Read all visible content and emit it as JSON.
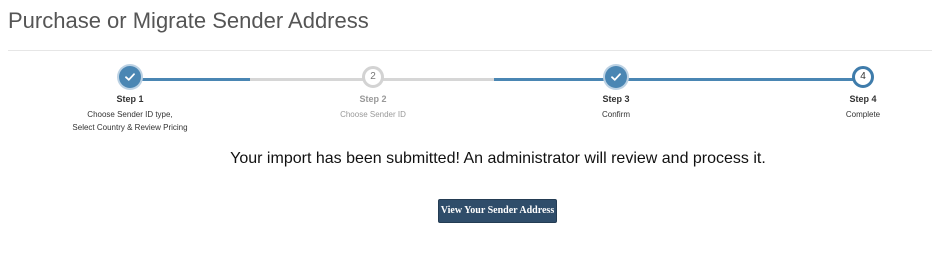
{
  "page": {
    "title": "Purchase or Migrate Sender Address"
  },
  "stepper": {
    "colors": {
      "done": "#4a86b3",
      "todo": "#d6d6d6",
      "current_ring": "#3f7cab"
    },
    "steps": [
      {
        "label": "Step 1",
        "description_lines": [
          "Choose Sender ID type,",
          "Select Country & Review Pricing"
        ],
        "status": "done",
        "icon": "check-icon"
      },
      {
        "label": "Step 2",
        "number": "2",
        "description_lines": [
          "Choose Sender ID"
        ],
        "status": "pending"
      },
      {
        "label": "Step 3",
        "description_lines": [
          "Confirm"
        ],
        "status": "done",
        "icon": "check-icon"
      },
      {
        "label": "Step 4",
        "number": "4",
        "description_lines": [
          "Complete"
        ],
        "status": "current"
      }
    ]
  },
  "main": {
    "message": "Your import has been submitted! An administrator will review and process it.",
    "view_button_label": "View Your Sender Address"
  }
}
